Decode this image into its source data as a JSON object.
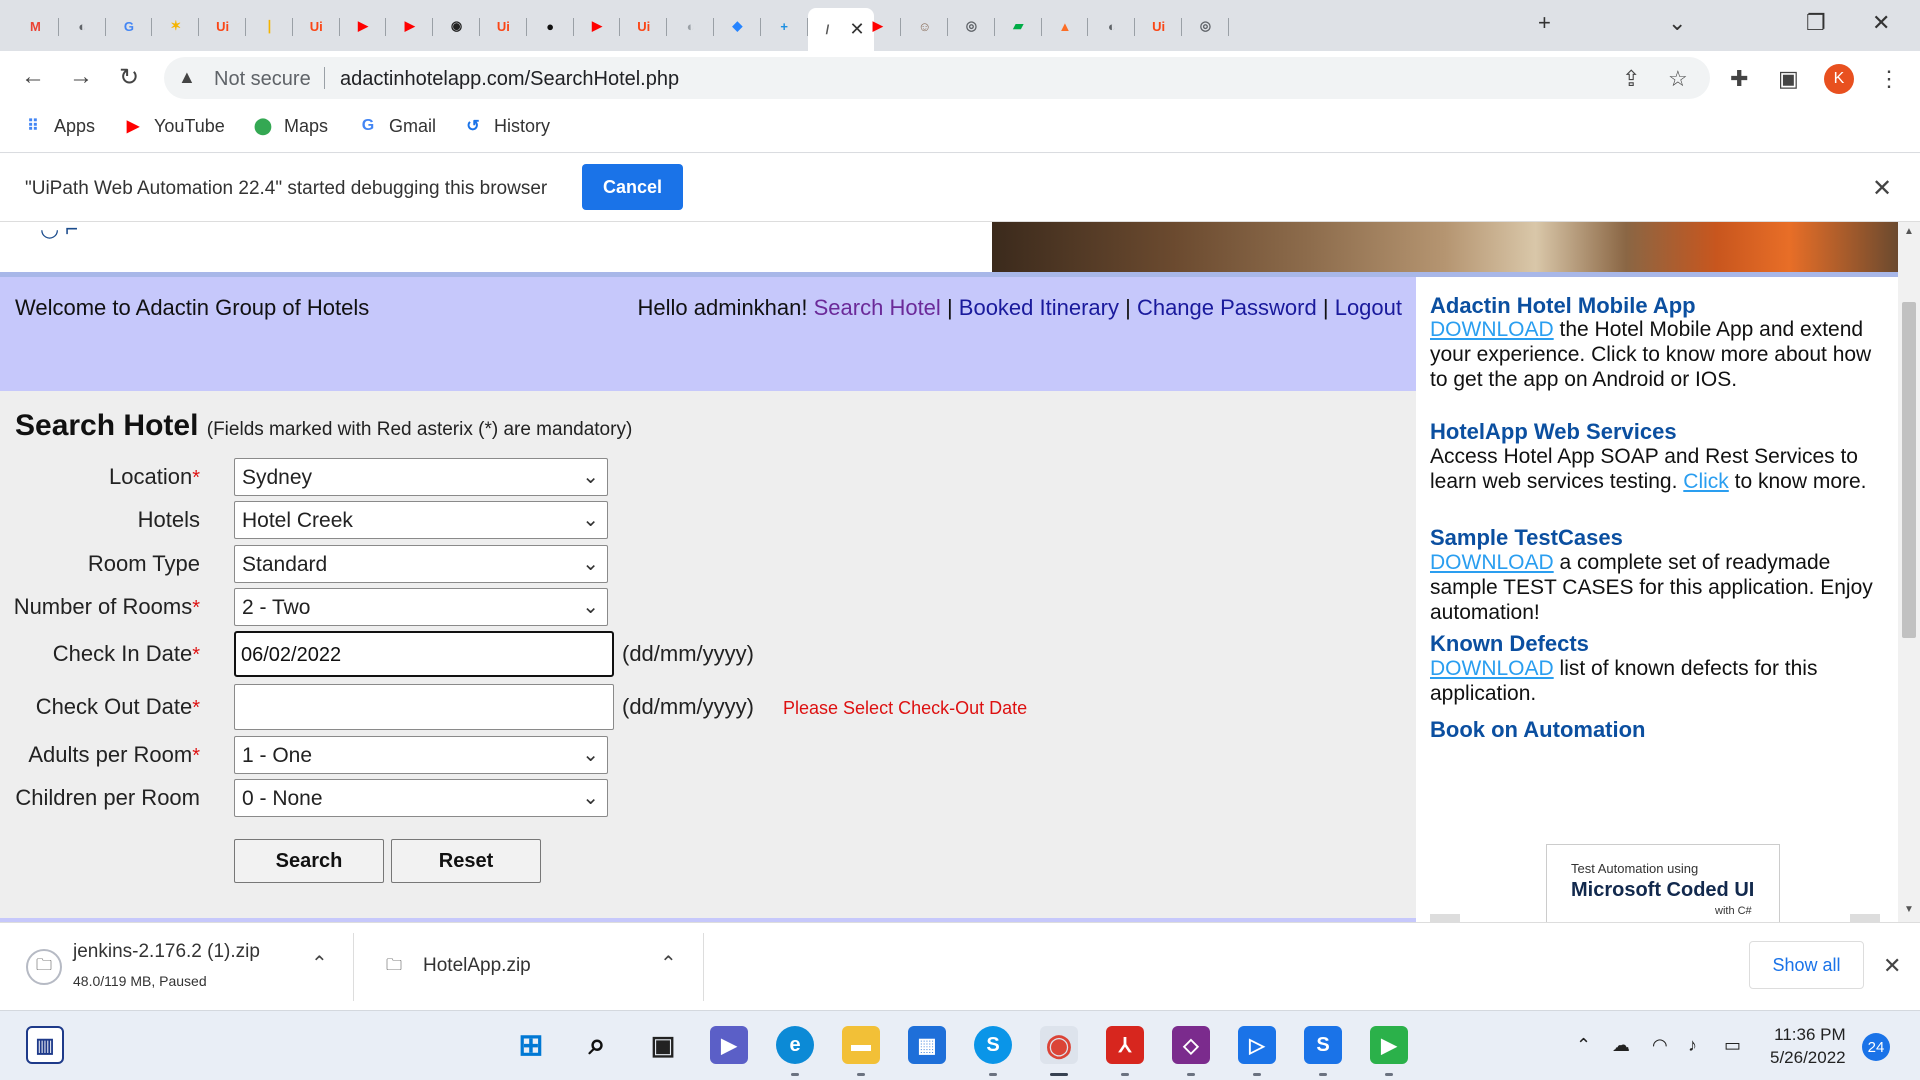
{
  "browser": {
    "tabs": [
      {
        "icon": "gmail-icon",
        "glyph": "M",
        "color": "#ea4335"
      },
      {
        "icon": "globe-icon",
        "glyph": "◐",
        "color": "#5f6368"
      },
      {
        "icon": "google-icon",
        "glyph": "G",
        "color": "#4285f4"
      },
      {
        "icon": "pinwheel-icon",
        "glyph": "✶",
        "color": "#f4b400"
      },
      {
        "icon": "uipath-icon",
        "glyph": "Ui",
        "color": "#fa4616"
      },
      {
        "icon": "bar-icon",
        "glyph": "❘",
        "color": "#f4b400"
      },
      {
        "icon": "uipath-icon",
        "glyph": "Ui",
        "color": "#fa4616"
      },
      {
        "icon": "youtube-icon",
        "glyph": "▶",
        "color": "#ff0000"
      },
      {
        "icon": "youtube-icon",
        "glyph": "▶",
        "color": "#ff0000"
      },
      {
        "icon": "robot-icon",
        "glyph": "◉",
        "color": "#222222"
      },
      {
        "icon": "uipath-icon",
        "glyph": "Ui",
        "color": "#fa4616"
      },
      {
        "icon": "github-icon",
        "glyph": "●",
        "color": "#111111"
      },
      {
        "icon": "youtube-icon",
        "glyph": "▶",
        "color": "#ff0000"
      },
      {
        "icon": "uipath-icon",
        "glyph": "Ui",
        "color": "#fa4616"
      },
      {
        "icon": "globe-icon",
        "glyph": "◐",
        "color": "#9aa0a6"
      },
      {
        "icon": "jira-icon",
        "glyph": "◆",
        "color": "#2684ff"
      },
      {
        "icon": "plus-square-icon",
        "glyph": "+",
        "color": "#1d8fe1"
      },
      {
        "icon": "page-icon",
        "glyph": "/",
        "color": "#555555"
      },
      {
        "icon": "youtube-icon",
        "glyph": "▶",
        "color": "#ff0000"
      },
      {
        "icon": "avatar-icon",
        "glyph": "☺",
        "color": "#8a6d5a"
      },
      {
        "icon": "chrome-icon",
        "glyph": "◎",
        "color": "#5f6368"
      },
      {
        "icon": "meet-icon",
        "glyph": "▰",
        "color": "#00ac47"
      },
      {
        "icon": "gitlab-icon",
        "glyph": "▲",
        "color": "#fc6d26"
      },
      {
        "icon": "globe-icon",
        "glyph": "◐",
        "color": "#5f6368"
      },
      {
        "icon": "uipath-icon",
        "glyph": "Ui",
        "color": "#fa4616"
      },
      {
        "icon": "chrome-icon",
        "glyph": "◎",
        "color": "#5f6368"
      }
    ],
    "active_tab_index": 17,
    "new_tab": "+",
    "address": {
      "security": "Not secure",
      "url": "adactinhotelapp.com/SearchHotel.php"
    },
    "bookmarks": [
      {
        "label": "Apps",
        "icon": "apps-grid-icon",
        "glyph": "⠿",
        "color": "#4285f4"
      },
      {
        "label": "YouTube",
        "icon": "youtube-icon",
        "glyph": "▶",
        "color": "#ff0000"
      },
      {
        "label": "Maps",
        "icon": "maps-pin-icon",
        "glyph": "⬤",
        "color": "#34a853"
      },
      {
        "label": "Gmail",
        "icon": "google-icon",
        "glyph": "G",
        "color": "#4285f4"
      },
      {
        "label": "History",
        "icon": "history-icon",
        "glyph": "↺",
        "color": "#1a73e8"
      }
    ],
    "profile_initial": "K"
  },
  "debug_bar": {
    "message": "\"UiPath Web Automation 22.4\" started debugging this browser",
    "cancel_label": "Cancel"
  },
  "page": {
    "welcome": "Welcome to Adactin Group of Hotels",
    "hello": "Hello adminkhan!",
    "nav": [
      "Search Hotel",
      "Booked Itinerary",
      "Change Password",
      "Logout"
    ],
    "separator": "|",
    "search": {
      "title": "Search Hotel",
      "note": "(Fields marked with Red asterix (*) are mandatory)",
      "fields": {
        "location": {
          "label": "Location",
          "value": "Sydney"
        },
        "hotels": {
          "label": "Hotels",
          "value": "Hotel Creek"
        },
        "room_type": {
          "label": "Room Type",
          "value": "Standard"
        },
        "rooms": {
          "label": "Number of Rooms",
          "value": "2 - Two"
        },
        "check_in": {
          "label": "Check In Date",
          "value": "06/02/2022",
          "hint": "(dd/mm/yyyy)"
        },
        "check_out": {
          "label": "Check Out Date",
          "value": "",
          "hint": "(dd/mm/yyyy)",
          "error": "Please Select Check-Out Date"
        },
        "adults": {
          "label": "Adults per Room",
          "value": "1 - One"
        },
        "children": {
          "label": "Children per Room",
          "value": "0 - None"
        }
      },
      "asterisk": "*",
      "search_label": "Search",
      "reset_label": "Reset"
    },
    "sidebar": {
      "mobile": {
        "title": "Adactin Hotel Mobile App",
        "link": "DOWNLOAD",
        "text": " the Hotel Mobile App and extend your experience. Click to know more about how to get the app on Android or IOS."
      },
      "web": {
        "title": "HotelApp Web Services",
        "text": "Access Hotel App SOAP and Rest Services to learn web services testing. ",
        "link": "Click",
        "text2": " to know more."
      },
      "tests": {
        "title": "Sample TestCases",
        "link": "DOWNLOAD",
        "text": " a complete set of readymade sample TEST CASES for this application. Enjoy automation!"
      },
      "defects": {
        "title": "Known Defects",
        "link": "DOWNLOAD",
        "text": " list of known defects for this application."
      },
      "book": {
        "title": "Book on Automation",
        "line1": "Test Automation using",
        "line2": "Microsoft Coded UI",
        "line3": "with C#"
      }
    }
  },
  "downloads": {
    "items": [
      {
        "name": "jenkins-2.176.2 (1).zip",
        "status": "48.0/119 MB, Paused"
      },
      {
        "name": "HotelApp.zip",
        "status": ""
      }
    ],
    "show_all": "Show all"
  },
  "taskbar": {
    "time": "11:36 PM",
    "date": "5/26/2022",
    "notifications": "24"
  }
}
